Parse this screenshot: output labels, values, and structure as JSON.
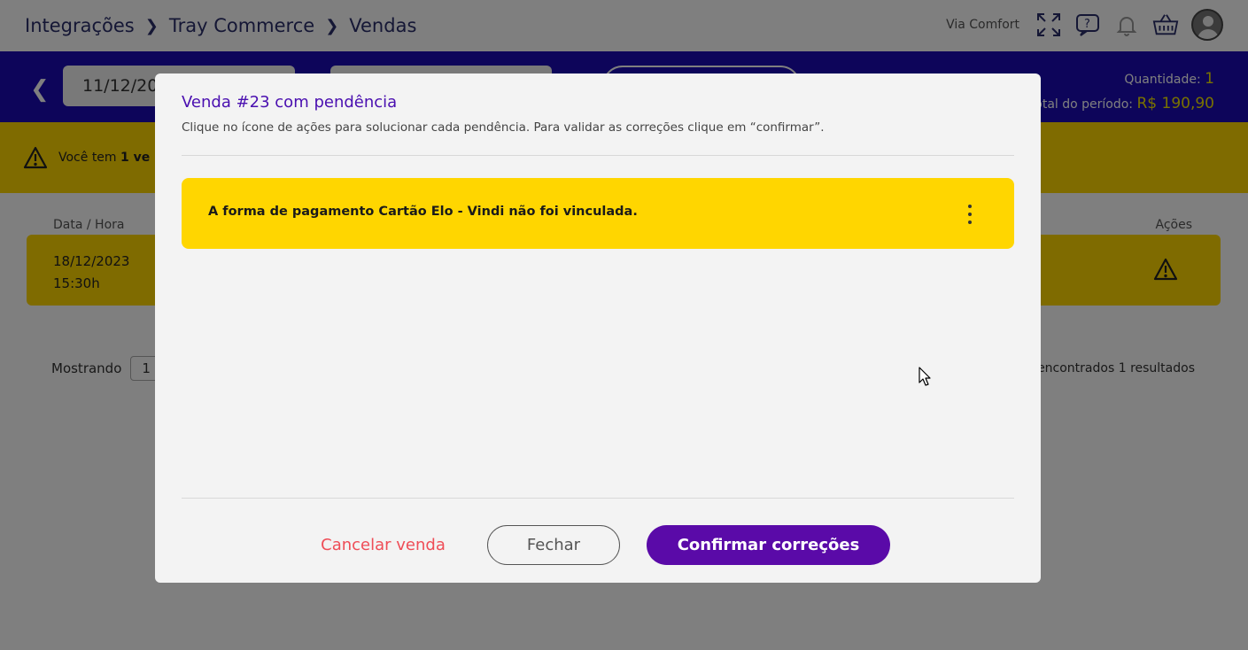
{
  "breadcrumb": {
    "items": [
      "Integrações",
      "Tray Commerce",
      "Vendas"
    ]
  },
  "header": {
    "store_name": "Via Comfort"
  },
  "filters": {
    "date_start": "11/12/20"
  },
  "summary": {
    "quantity_label": "Quantidade:",
    "quantity_value": "1",
    "total_label": "otal do período:",
    "total_value": "R$ 190,90"
  },
  "alert": {
    "prefix": "Você tem",
    "bold": "1 ve"
  },
  "table": {
    "columns": [
      "Data / Hora",
      "Ações"
    ],
    "rows": [
      {
        "date": "18/12/2023",
        "time": "15:30h"
      }
    ]
  },
  "pagination": {
    "label": "Mostrando",
    "page_size": "1",
    "results_text": "encontrados 1 resultados"
  },
  "modal": {
    "title": "Venda #23 com pendência",
    "subtitle": "Clique no ícone de ações para solucionar cada pendência. Para validar as correções clique em “confirmar”.",
    "issues": [
      {
        "text": "A forma de pagamento Cartão Elo - Vindi não foi vinculada."
      }
    ],
    "cancel_label": "Cancelar venda",
    "close_label": "Fechar",
    "confirm_label": "Confirmar correções"
  },
  "colors": {
    "primary_blue": "#1a0bb5",
    "warning_yellow": "#ffd600",
    "confirm_purple": "#5a0aa8",
    "cancel_red": "#ef4d57"
  },
  "icons": [
    "fullscreen-icon",
    "help-icon",
    "bell-icon",
    "basket-icon",
    "avatar-icon",
    "warning-icon",
    "kebab-menu-icon",
    "back-chevron-icon"
  ]
}
